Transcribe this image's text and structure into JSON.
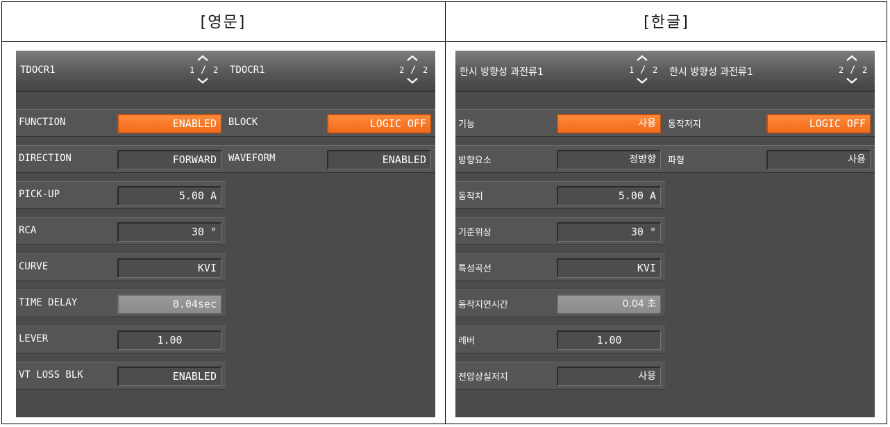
{
  "headings": {
    "english": "[영문]",
    "korean": "[한글]"
  },
  "pager_current": [
    "1",
    "2"
  ],
  "pager_total": "2",
  "english": {
    "page1": {
      "title": "TDOCR1",
      "rows": [
        {
          "label": "FUNCTION",
          "value": "ENABLED"
        },
        {
          "label": "DIRECTION",
          "value": "FORWARD"
        },
        {
          "label": "PICK-UP",
          "value": "5.00 A"
        },
        {
          "label": "RCA",
          "value": "30 °"
        },
        {
          "label": "CURVE",
          "value": "KVI"
        },
        {
          "label": "TIME DELAY",
          "value": "0.04sec"
        },
        {
          "label": "LEVER",
          "value": "1.00"
        },
        {
          "label": "VT LOSS BLK",
          "value": "ENABLED"
        }
      ]
    },
    "page2": {
      "title": "TDOCR1",
      "rows": [
        {
          "label": "BLOCK",
          "value": "LOGIC OFF"
        },
        {
          "label": "WAVEFORM",
          "value": "ENABLED"
        }
      ]
    }
  },
  "korean": {
    "page1": {
      "title": "한시 방향성 과전류1",
      "rows": [
        {
          "label": "기능",
          "value": "사용"
        },
        {
          "label": "방향요소",
          "value": "정방향"
        },
        {
          "label": "동작치",
          "value": "5.00 A"
        },
        {
          "label": "기준위상",
          "value": "30 °"
        },
        {
          "label": "특성곡선",
          "value": "KVI"
        },
        {
          "label": "동작지연시간",
          "value": "0.04 초"
        },
        {
          "label": "레버",
          "value": "1.00"
        },
        {
          "label": "전압상실저지",
          "value": "사용"
        }
      ]
    },
    "page2": {
      "title": "한시 방향성 과전류1",
      "rows": [
        {
          "label": "동작저지",
          "value": "LOGIC OFF"
        },
        {
          "label": "파형",
          "value": "사용"
        }
      ]
    }
  },
  "colors": {
    "selected": "#f06a1a",
    "editing": "#8f8f8f",
    "panel": "#4b4b4b"
  }
}
